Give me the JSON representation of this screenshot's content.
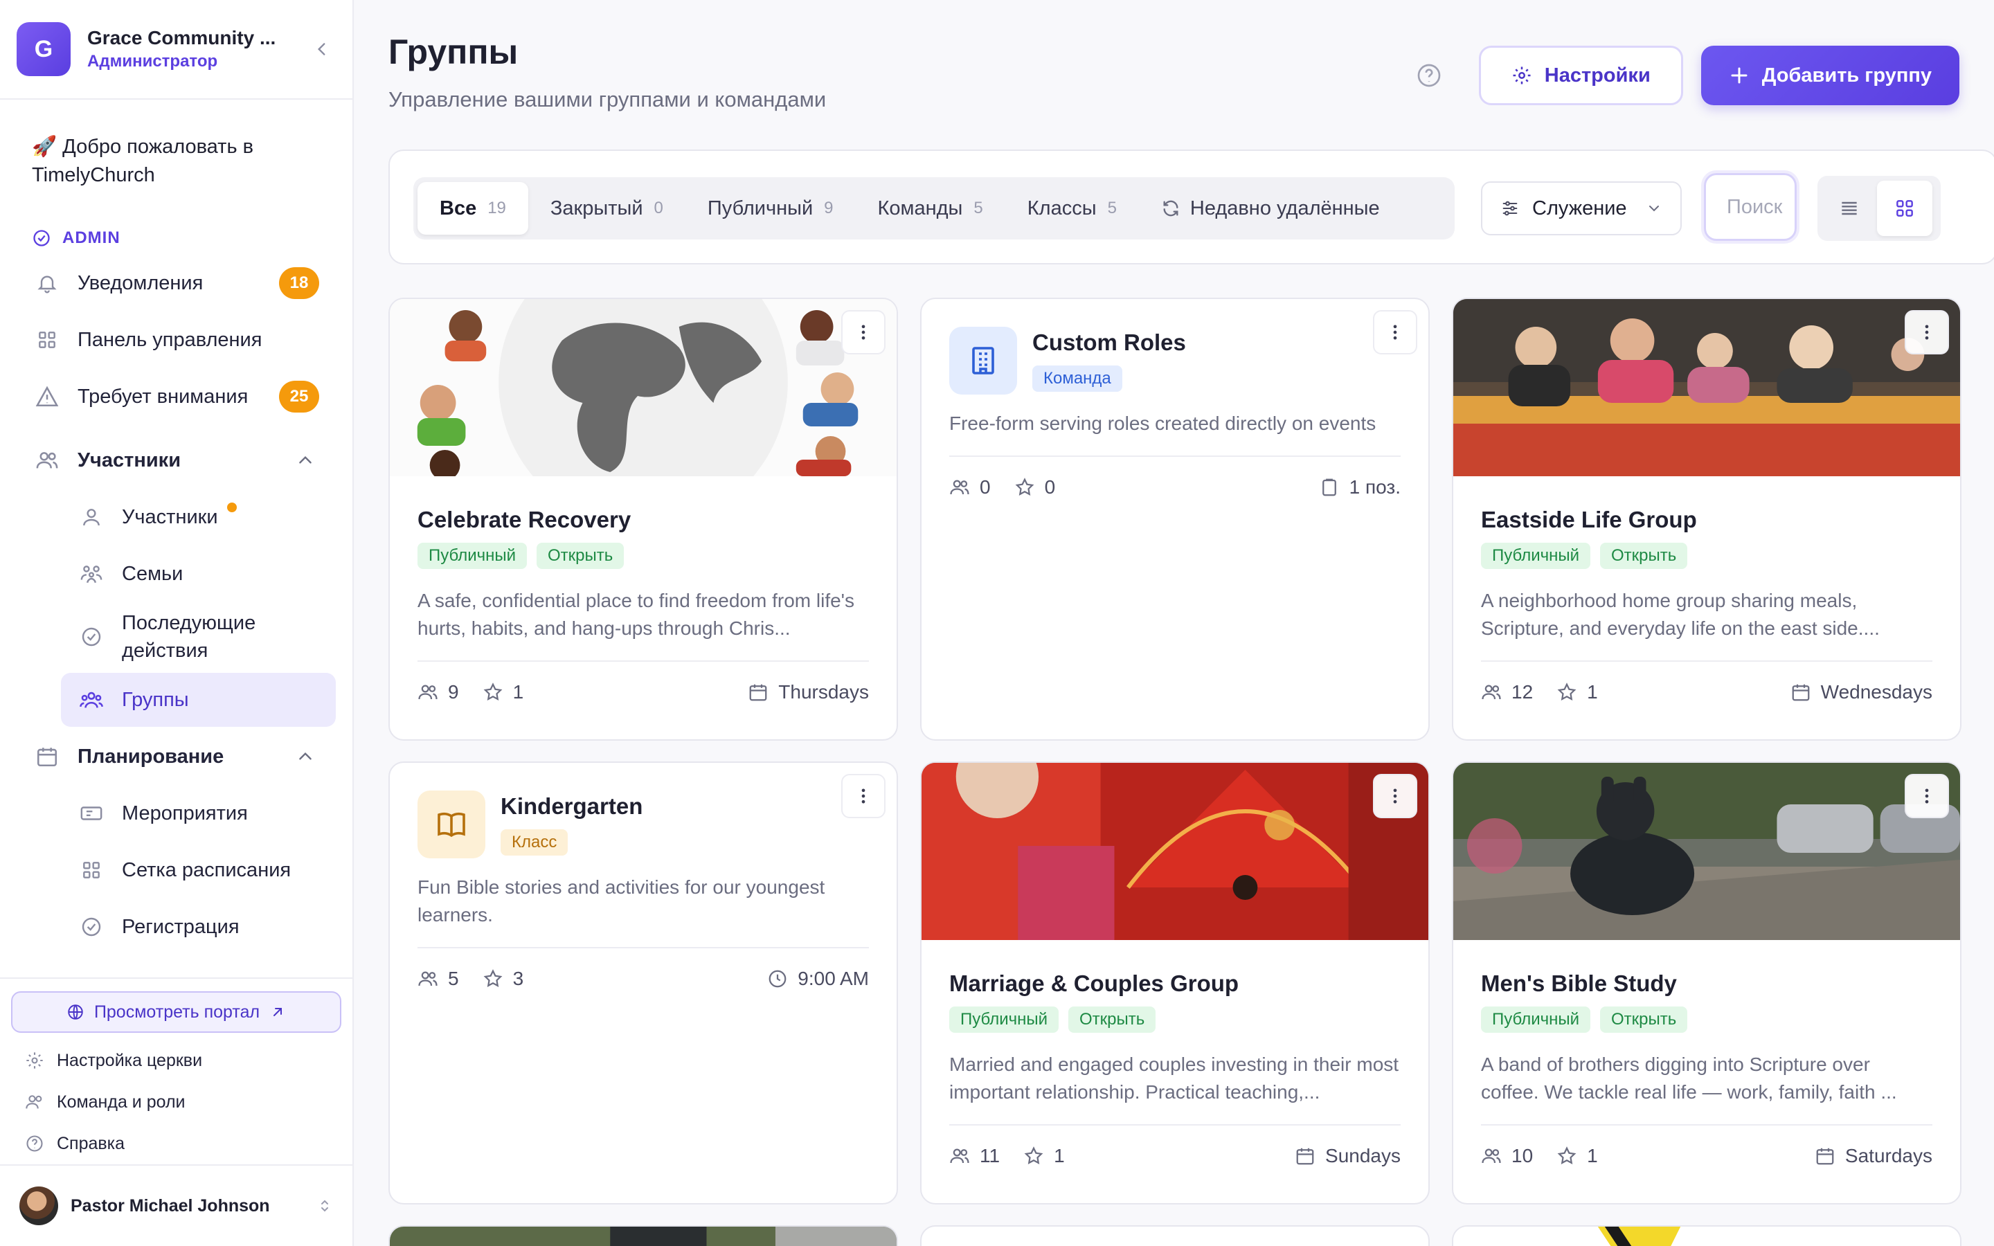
{
  "sidebar": {
    "org_initial": "G",
    "org_name": "Grace Community ...",
    "org_role": "Администратор",
    "welcome": "🚀 Добро пожаловать в TimelyChurch",
    "admin_label": "ADMIN",
    "items": {
      "notifications": {
        "label": "Уведомления",
        "count": "18"
      },
      "dashboard": {
        "label": "Панель управления"
      },
      "attention": {
        "label": "Требует внимания",
        "count": "25"
      },
      "members_group": {
        "label": "Участники"
      },
      "members": {
        "label": "Участники"
      },
      "families": {
        "label": "Семьи"
      },
      "followups": {
        "label": "Последующие действия"
      },
      "groups": {
        "label": "Группы"
      },
      "planning_group": {
        "label": "Планирование"
      },
      "events": {
        "label": "Мероприятия"
      },
      "schedule": {
        "label": "Сетка расписания"
      },
      "registration": {
        "label": "Регистрация"
      }
    },
    "portal_button": "Просмотреть портал",
    "footer": {
      "church_setup": "Настройка церкви",
      "team_roles": "Команда и роли",
      "help": "Справка"
    },
    "user_name": "Pastor Michael Johnson"
  },
  "header": {
    "title": "Группы",
    "subtitle": "Управление вашими группами и командами",
    "settings_button": "Настройки",
    "add_button": "Добавить группу"
  },
  "filters": {
    "tabs": [
      {
        "label": "Все",
        "count": "19"
      },
      {
        "label": "Закрытый",
        "count": "0"
      },
      {
        "label": "Публичный",
        "count": "9"
      },
      {
        "label": "Команды",
        "count": "5"
      },
      {
        "label": "Классы",
        "count": "5"
      }
    ],
    "recently_deleted": "Недавно удалённые",
    "service_dropdown": "Служение",
    "search_placeholder": "Поиск"
  },
  "cards": [
    {
      "title": "Celebrate Recovery",
      "tags": [
        "Публичный",
        "Открыть"
      ],
      "desc": "A safe, confidential place to find freedom from life's hurts, habits, and hang-ups through Chris...",
      "members": "9",
      "leaders": "1",
      "schedule": "Thursdays"
    },
    {
      "title": "Custom Roles",
      "tags": [
        "Команда"
      ],
      "desc": "Free-form serving roles created directly on events",
      "members": "0",
      "leaders": "0",
      "schedule": "1 поз."
    },
    {
      "title": "Eastside Life Group",
      "tags": [
        "Публичный",
        "Открыть"
      ],
      "desc": "A neighborhood home group sharing meals, Scripture, and everyday life on the east side....",
      "members": "12",
      "leaders": "1",
      "schedule": "Wednesdays"
    },
    {
      "title": "Kindergarten",
      "tags": [
        "Класс"
      ],
      "desc": "Fun Bible stories and activities for our youngest learners.",
      "members": "5",
      "leaders": "3",
      "schedule": "9:00 AM"
    },
    {
      "title": "Marriage & Couples Group",
      "tags": [
        "Публичный",
        "Открыть"
      ],
      "desc": "Married and engaged couples investing in their most important relationship. Practical teaching,...",
      "members": "11",
      "leaders": "1",
      "schedule": "Sundays"
    },
    {
      "title": "Men's Bible Study",
      "tags": [
        "Публичный",
        "Открыть"
      ],
      "desc": "A band of brothers digging into Scripture over coffee. We tackle real life — work, family, faith ...",
      "members": "10",
      "leaders": "1",
      "schedule": "Saturdays"
    }
  ],
  "colors": {
    "accent": "#5b3fe0",
    "badge": "#f59a0c",
    "tag_green": "#1e8a44",
    "tag_blue": "#2d5fd6",
    "tag_amber": "#b5700c"
  }
}
